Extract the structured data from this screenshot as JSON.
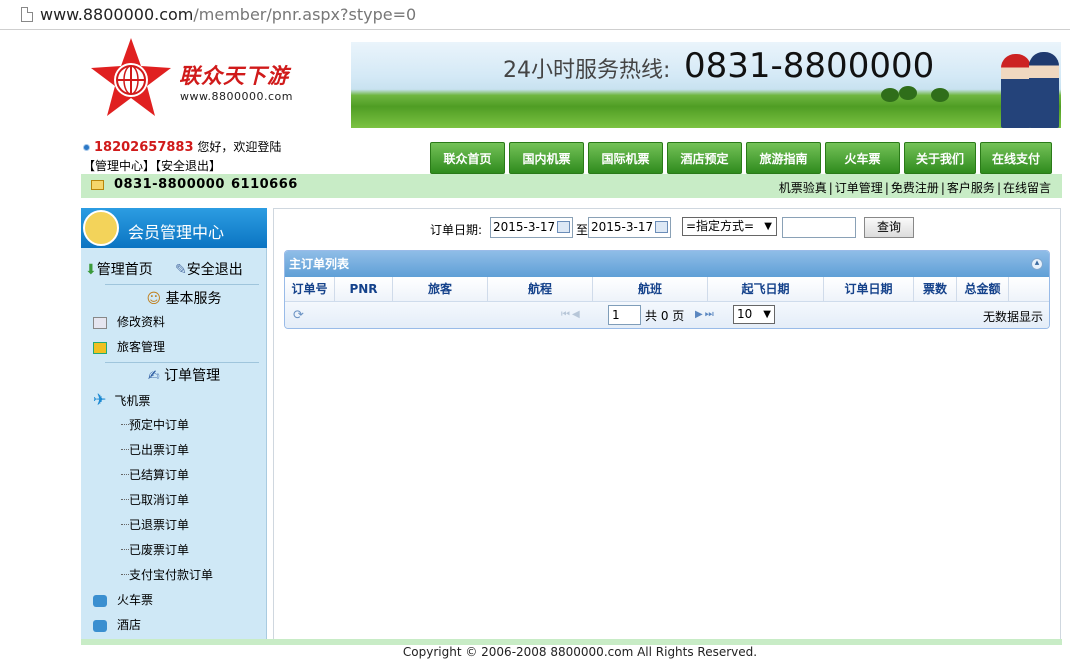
{
  "browser": {
    "url_host": "www.8800000.com",
    "url_path": "/member/pnr.aspx?stype=0"
  },
  "header": {
    "brand_name": "联众天下游",
    "brand_site": "www.8800000.com",
    "banner_hotline_label": "24小时服务热线:",
    "banner_hotline_number": "0831-8800000"
  },
  "user": {
    "phone": "18202657883",
    "greeting": "您好，欢迎登陆",
    "admin_link": "【管理中心】",
    "logout_link": "【安全退出】"
  },
  "nav": [
    "联众首页",
    "国内机票",
    "国际机票",
    "酒店预定",
    "旅游指南",
    "火车票",
    "关于我们",
    "在线支付"
  ],
  "contact_bar": {
    "tel": "0831-8800000",
    "tel2": "6110666",
    "links": [
      "机票验真",
      "订单管理",
      "免费注册",
      "客户服务",
      "在线留言"
    ],
    "separator": "|"
  },
  "sidebar": {
    "title": "会员管理中心",
    "home": "管理首页",
    "logout": "安全退出",
    "basic_section": "基本服务",
    "basic_items": [
      "修改资料",
      "旅客管理"
    ],
    "order_section": "订单管理",
    "flight_item": "飞机票",
    "flight_subitems": [
      "预定中订单",
      "已出票订单",
      "已结算订单",
      "已取消订单",
      "已退票订单",
      "已废票订单",
      "支付宝付款订单"
    ],
    "train_item": "火车票",
    "hotel_item": "酒店"
  },
  "filter": {
    "label": "订单日期:",
    "date_from": "2015-3-17",
    "to_label": "至",
    "date_to": "2015-3-17",
    "method_select": "=指定方式=",
    "search_value": "",
    "query_button": "查询"
  },
  "grid": {
    "title": "主订单列表",
    "columns": [
      "订单号",
      "PNR",
      "旅客",
      "航程",
      "航班",
      "起飞日期",
      "订单日期",
      "票数",
      "总金额"
    ],
    "page_value": "1",
    "page_total": "共 0 页",
    "page_size": "10",
    "empty_text": "无数据显示"
  },
  "footer": {
    "copyright": "Copyright © 2006-2008 8800000.com All Rights Reserved."
  }
}
